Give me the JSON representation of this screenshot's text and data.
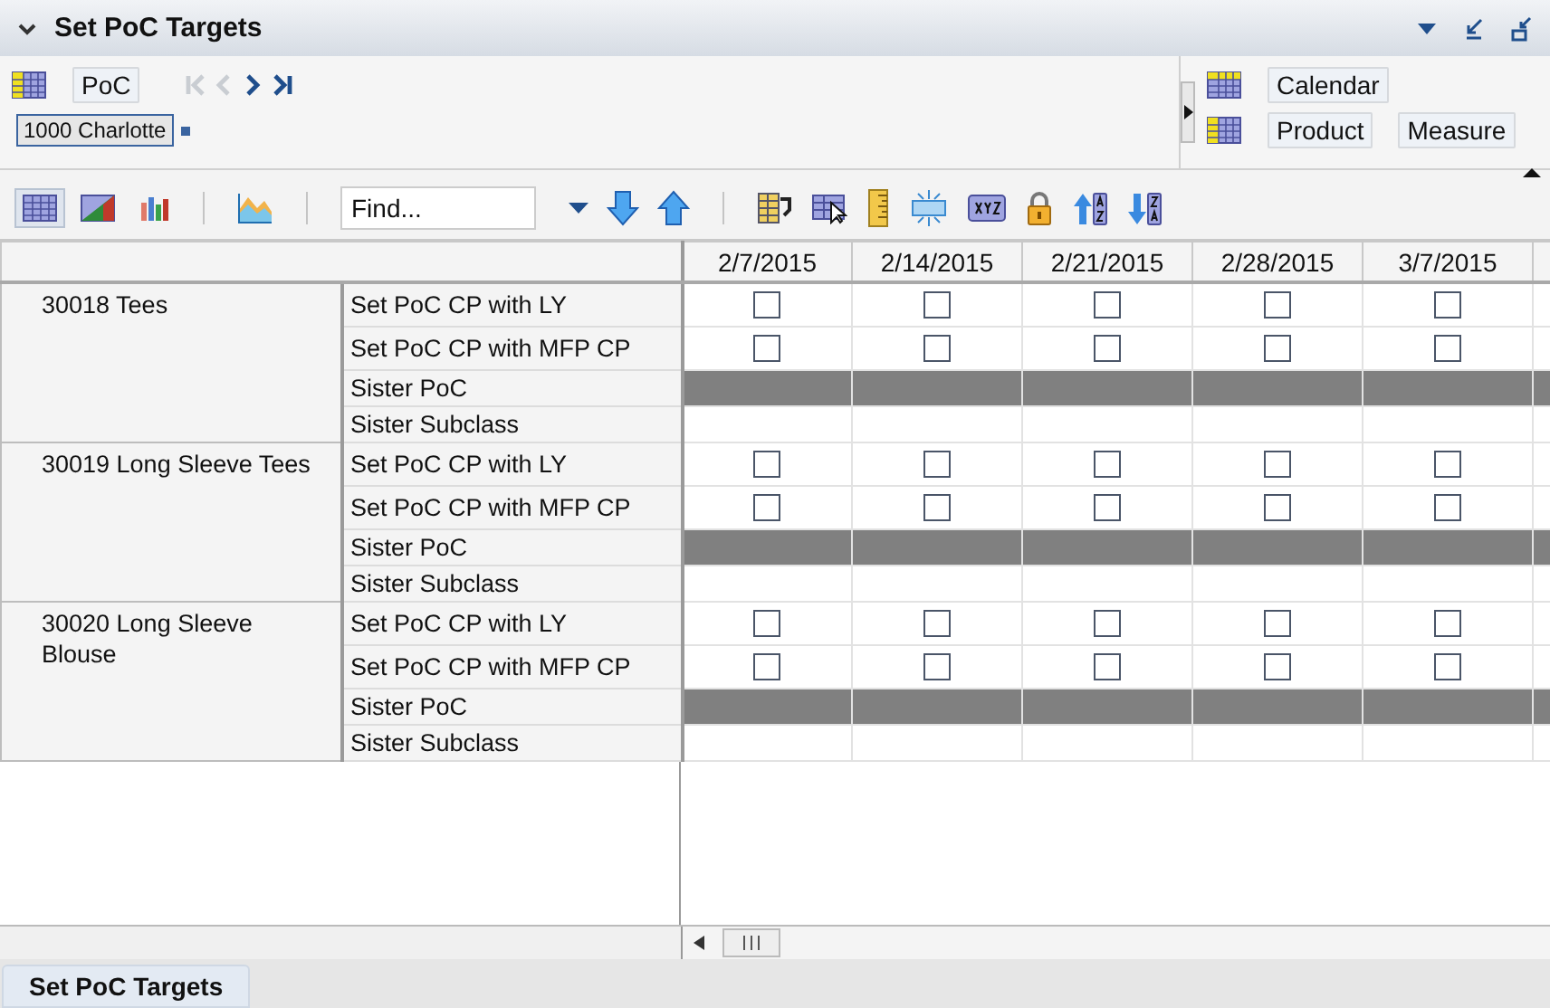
{
  "window": {
    "title": "Set PoC Targets"
  },
  "pivot": {
    "rows_label": "PoC",
    "nav": [
      {
        "kind": "first",
        "disabled": true
      },
      {
        "kind": "prev",
        "disabled": true
      },
      {
        "kind": "next",
        "disabled": false
      },
      {
        "kind": "last",
        "disabled": false
      }
    ],
    "filter_chip": "1000 Charlotte",
    "column_labels": [
      "Calendar"
    ],
    "row_labels": [
      "Product",
      "Measure"
    ]
  },
  "toolbar": {
    "views": [
      {
        "kind": "grid",
        "selected": true
      },
      {
        "kind": "grid-chart",
        "selected": false
      },
      {
        "kind": "bar-chart",
        "selected": false
      }
    ],
    "find": {
      "placeholder": "Find..."
    },
    "tools": [
      {
        "kind": "columns"
      },
      {
        "kind": "select"
      },
      {
        "kind": "ruler"
      },
      {
        "kind": "split"
      },
      {
        "kind": "xyz"
      },
      {
        "kind": "lock"
      },
      {
        "kind": "sort-asc"
      },
      {
        "kind": "sort-desc"
      }
    ]
  },
  "table": {
    "columns": [
      "2/7/2015",
      "2/14/2015",
      "2/21/2015",
      "2/28/2015",
      "3/7/2015"
    ],
    "groups": [
      {
        "name": "30018 Tees",
        "rows": [
          {
            "label": "Set PoC CP with LY",
            "kind": "checkbox",
            "cells": [
              {
                "checked": false
              },
              {
                "checked": false
              },
              {
                "checked": false
              },
              {
                "checked": false
              },
              {
                "checked": false
              }
            ]
          },
          {
            "label": "Set PoC CP with MFP CP",
            "kind": "checkbox",
            "cells": [
              {
                "checked": false
              },
              {
                "checked": false
              },
              {
                "checked": false
              },
              {
                "checked": false
              },
              {
                "checked": false
              }
            ]
          },
          {
            "label": "Sister PoC",
            "kind": "shaded"
          },
          {
            "label": "Sister Subclass",
            "kind": "empty"
          }
        ]
      },
      {
        "name": "30019 Long Sleeve Tees",
        "rows": [
          {
            "label": "Set PoC CP with LY",
            "kind": "checkbox",
            "cells": [
              {
                "checked": false
              },
              {
                "checked": false
              },
              {
                "checked": false
              },
              {
                "checked": false
              },
              {
                "checked": false
              }
            ]
          },
          {
            "label": "Set PoC CP with MFP CP",
            "kind": "checkbox",
            "cells": [
              {
                "checked": false
              },
              {
                "checked": false
              },
              {
                "checked": false
              },
              {
                "checked": false
              },
              {
                "checked": false
              }
            ]
          },
          {
            "label": "Sister PoC",
            "kind": "shaded"
          },
          {
            "label": "Sister Subclass",
            "kind": "empty"
          }
        ]
      },
      {
        "name": "30020 Long Sleeve Blouse",
        "rows": [
          {
            "label": "Set PoC CP with LY",
            "kind": "checkbox",
            "cells": [
              {
                "checked": false
              },
              {
                "checked": false
              },
              {
                "checked": false
              },
              {
                "checked": false
              },
              {
                "checked": false
              }
            ]
          },
          {
            "label": "Set PoC CP with MFP CP",
            "kind": "checkbox",
            "cells": [
              {
                "checked": false
              },
              {
                "checked": false
              },
              {
                "checked": false
              },
              {
                "checked": false
              },
              {
                "checked": false
              }
            ]
          },
          {
            "label": "Sister PoC",
            "kind": "shaded"
          },
          {
            "label": "Sister Subclass",
            "kind": "empty"
          }
        ]
      }
    ]
  },
  "bottom_tabs": [
    {
      "label": "Set PoC Targets",
      "selected": true
    }
  ]
}
